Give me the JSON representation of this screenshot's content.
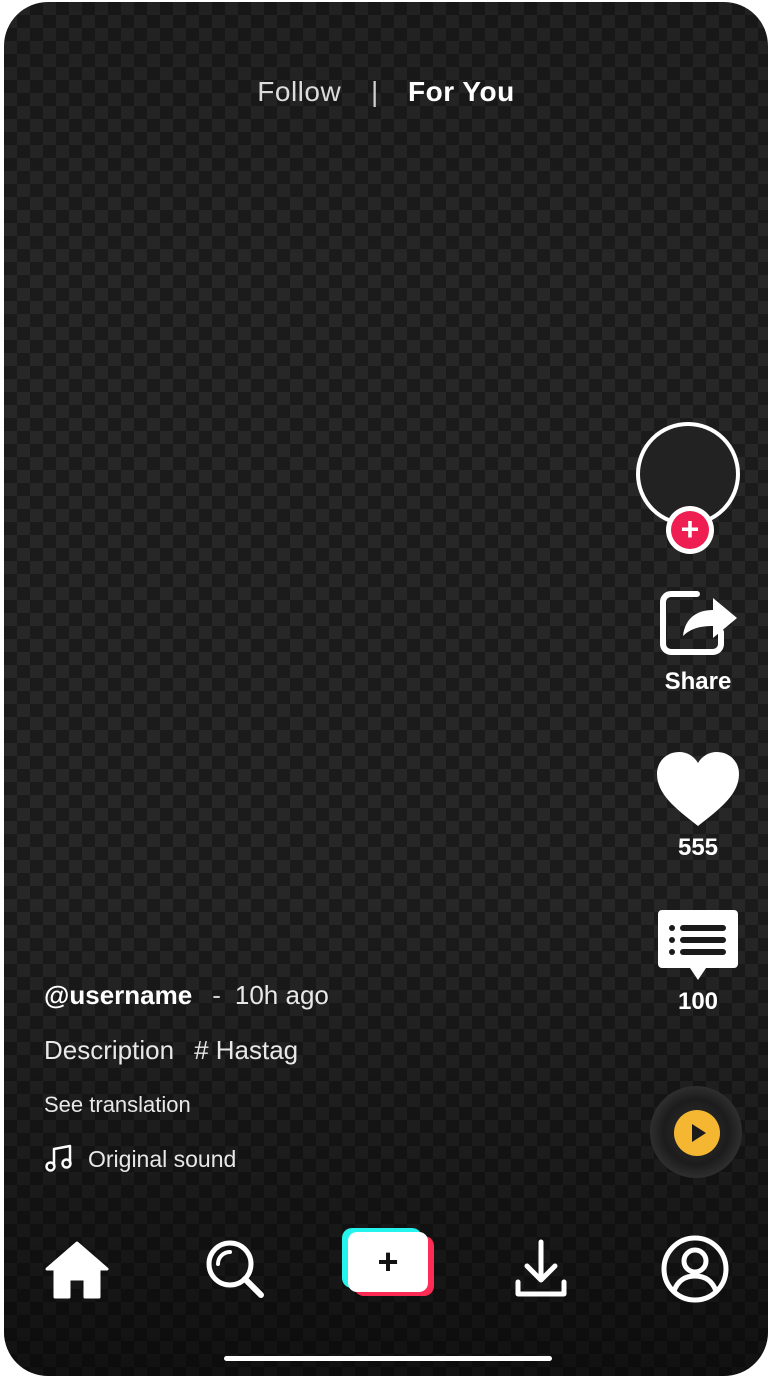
{
  "top_tabs": {
    "follow": "Follow",
    "separator": "|",
    "for_you": "For You"
  },
  "side_actions": {
    "follow_badge": "+",
    "share_label": "Share",
    "like_count": "555",
    "comment_count": "100"
  },
  "video_info": {
    "username": "@username",
    "dash": "-",
    "time_ago": "10h ago",
    "description": "Description",
    "hashtag": "# Hastag",
    "see_translation": "See translation",
    "sound": "Original sound"
  },
  "bottom_nav": {
    "items": [
      "home-icon",
      "search-icon",
      "create-icon",
      "download-icon",
      "profile-icon"
    ],
    "create_symbol": "+"
  },
  "colors": {
    "accent_pink": "#fe2c55",
    "accent_cyan": "#25f4ee",
    "badge_red": "#ee1d52",
    "music_yellow": "#f5b731"
  }
}
